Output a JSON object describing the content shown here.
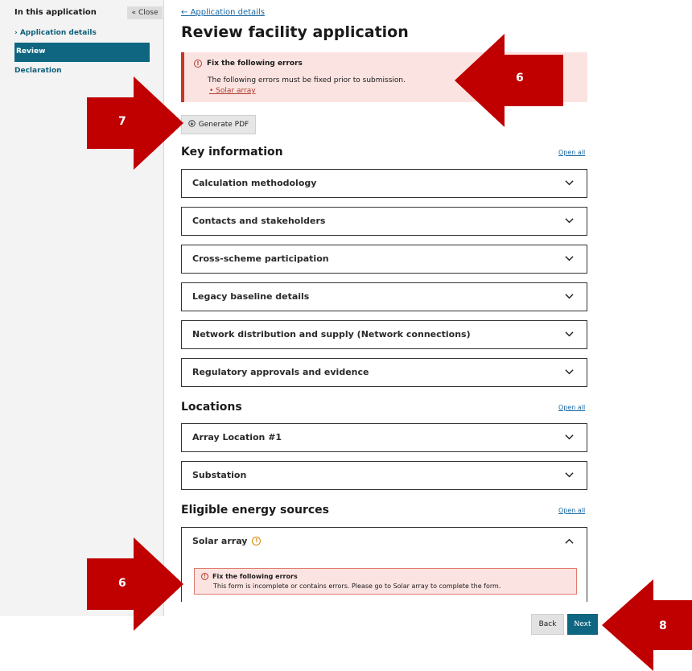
{
  "sidebar": {
    "heading": "In this application",
    "close_label": "Close",
    "items": [
      {
        "label": "Application details"
      },
      {
        "label": "Review"
      },
      {
        "label": "Declaration"
      }
    ]
  },
  "header": {
    "back_link": "Application details",
    "title": "Review facility application"
  },
  "error_summary": {
    "title": "Fix the following errors",
    "message": "The following errors must be fixed prior to submission.",
    "link": "Solar array"
  },
  "generate_pdf_label": "Generate PDF",
  "sections": [
    {
      "title": "Key information",
      "open_all": "Open all",
      "items": [
        "Calculation methodology",
        "Contacts and stakeholders",
        "Cross-scheme participation",
        "Legacy baseline details",
        "Network distribution and supply (Network connections)",
        "Regulatory approvals and evidence"
      ]
    },
    {
      "title": "Locations",
      "open_all": "Open all",
      "items": [
        "Array Location #1",
        "Substation"
      ]
    },
    {
      "title": "Eligible energy sources",
      "open_all": "Open all",
      "items": [
        "Solar array"
      ]
    }
  ],
  "solar_error": {
    "title": "Fix the following errors",
    "message": "This form is incomplete or contains errors. Please go to Solar array to complete the form."
  },
  "footer": {
    "back_label": "Back",
    "next_label": "Next"
  },
  "annotations": [
    "6",
    "7",
    "6",
    "8"
  ],
  "colors": {
    "accent": "#0f6680",
    "error_bg": "#fbe3e1",
    "error_border": "#c0392b",
    "annotation_arrow": "#c00000",
    "warning_amber": "#d4890a"
  }
}
